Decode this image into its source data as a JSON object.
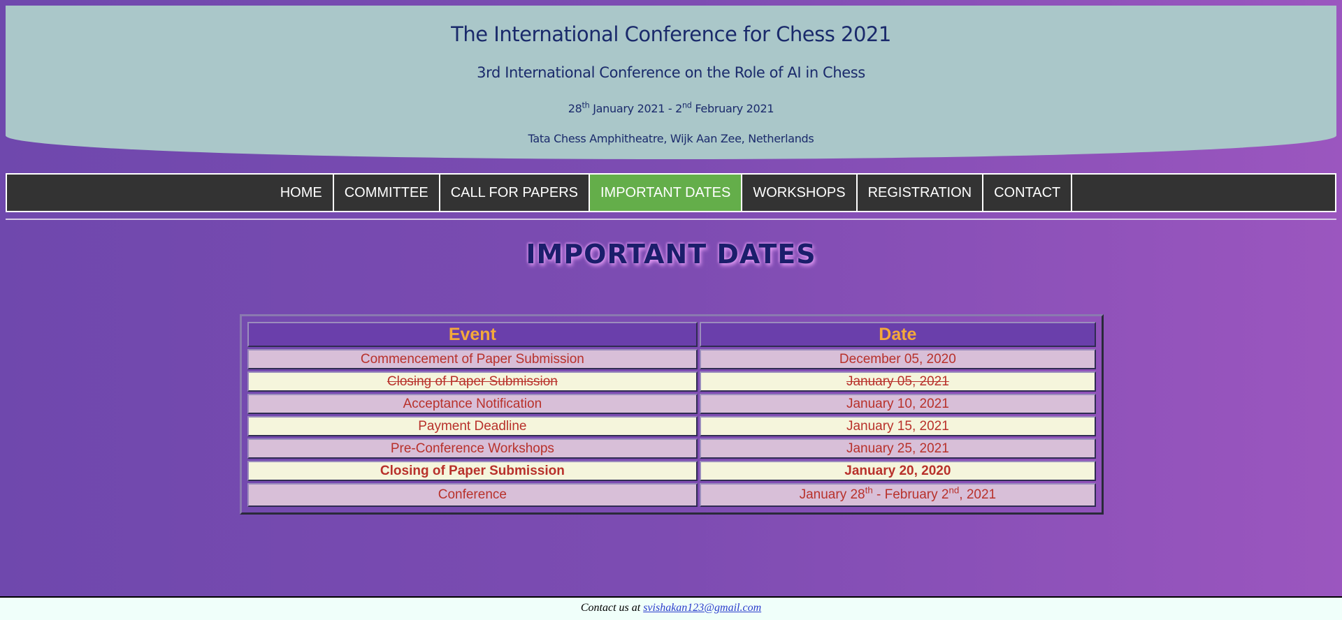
{
  "banner": {
    "title": "The International Conference for Chess 2021",
    "subtitle": "3rd International Conference on the Role of AI in Chess",
    "dates": {
      "p1": "28",
      "s1": "th",
      "p2": " January 2021 - 2",
      "s2": "nd",
      "p3": " February 2021"
    },
    "venue": "Tata Chess Amphitheatre, Wijk Aan Zee, Netherlands"
  },
  "nav": {
    "items": [
      "HOME",
      "COMMITTEE",
      "CALL FOR PAPERS",
      "IMPORTANT DATES",
      "WORKSHOPS",
      "REGISTRATION",
      "CONTACT"
    ],
    "active": "IMPORTANT DATES"
  },
  "heading": "IMPORTANT DATES",
  "table": {
    "headers": [
      "Event",
      "Date"
    ],
    "rows": [
      {
        "event": "Commencement of Paper Submission",
        "date": "December 05, 2020"
      },
      {
        "event": "Closing of Paper Submission",
        "date": "January 05, 2021",
        "style": "strikethrough"
      },
      {
        "event": "Acceptance Notification",
        "date": "January 10, 2021"
      },
      {
        "event": "Payment Deadline",
        "date": "January 15, 2021"
      },
      {
        "event": "Pre-Conference Workshops",
        "date": "January 25, 2021"
      },
      {
        "event": "Closing of Paper Submission",
        "date": "January 20, 2020",
        "style": "bold"
      },
      {
        "event": "Conference",
        "date_parts": {
          "p1": "January 28",
          "s1": "th",
          "p2": " - February 2",
          "s2": "nd",
          "p3": ", 2021"
        }
      }
    ]
  },
  "footer": {
    "text": "Contact us at ",
    "email": "svishakan123@gmail.com"
  },
  "colors": {
    "nav_active": "#64ae4a",
    "nav_bg": "#333333",
    "header_text": "#f4a93a",
    "cell_text": "#b8312b",
    "row_odd": "#d8bfd8",
    "row_even": "#f5f5dc",
    "banner_bg": "#aac7c9"
  }
}
